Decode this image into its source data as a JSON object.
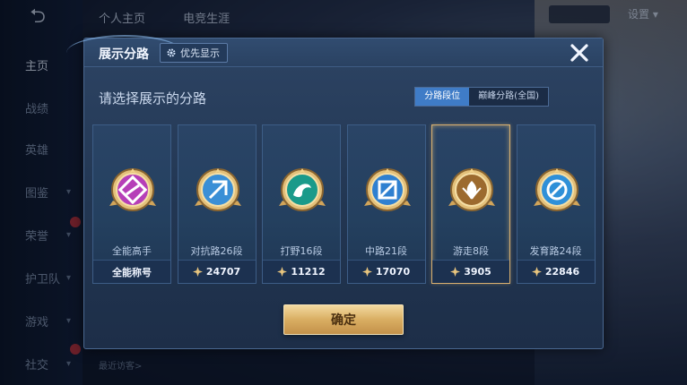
{
  "background": {
    "back_glyph": "⮌",
    "nav": [
      {
        "label": "主页",
        "active": true
      },
      {
        "label": "战绩"
      },
      {
        "label": "英雄"
      },
      {
        "label": "图鉴"
      },
      {
        "label": "荣誉"
      },
      {
        "label": "护卫队"
      },
      {
        "label": "游戏"
      },
      {
        "label": "社交"
      }
    ],
    "tabs": [
      "个人主页",
      "电竞生涯"
    ],
    "settings_label": "设置",
    "visitors_label": "最近访客>"
  },
  "modal": {
    "title": "展示分路",
    "priority_label": "优先显示",
    "subtitle": "请选择展示的分路",
    "toggle": [
      "分路段位",
      "巅峰分路(全国)"
    ],
    "confirm_label": "确定",
    "cards": [
      {
        "label": "全能高手",
        "foot": "全能称号",
        "points": null,
        "color": "#b63fb8"
      },
      {
        "label": "对抗路26段",
        "foot": "24707",
        "points": 24707,
        "color": "#3a8fd6"
      },
      {
        "label": "打野16段",
        "foot": "11212",
        "points": 11212,
        "color": "#1a9a8a"
      },
      {
        "label": "中路21段",
        "foot": "17070",
        "points": 17070,
        "color": "#2f80d0"
      },
      {
        "label": "游走8段",
        "foot": "3905",
        "points": 3905,
        "color": "#9c6a2e",
        "selected": true
      },
      {
        "label": "发育路24段",
        "foot": "22846",
        "points": 22846,
        "color": "#2f90d8"
      }
    ]
  },
  "colors": {
    "gold": "#d9ae62",
    "accent_blue": "#3f7cc7"
  }
}
